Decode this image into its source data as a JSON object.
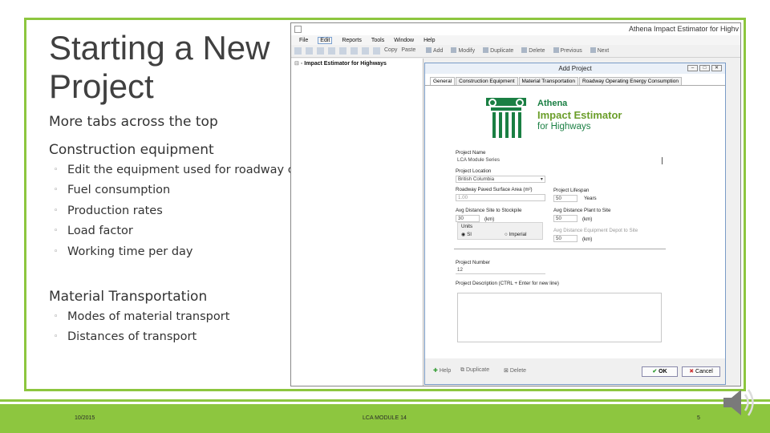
{
  "slide": {
    "title": "Starting a New Project",
    "subtitle": "More tabs across the top",
    "section1": "Construction equipment",
    "section1_items": [
      "Edit the equipment used for roadway construction",
      "Fuel consumption",
      "Production rates",
      "Load factor",
      "Working time per day"
    ],
    "section2": "Material Transportation",
    "section2_items": [
      "Modes of material transport",
      "Distances of transport"
    ],
    "bullet_glyph": "◦",
    "accent_color": "#8dc63f"
  },
  "footer": {
    "date": "10/2015",
    "module": "LCA MODULE 14",
    "page": "5"
  },
  "app": {
    "window_title": "Athena Impact Estimator for Highv",
    "menu": [
      "File",
      "Edit",
      "Reports",
      "Tools",
      "Window",
      "Help"
    ],
    "toolbar_left_count": 8,
    "toolbar_left": [
      "Copy",
      "Paste"
    ],
    "toolbar_right": [
      "Add",
      "Modify",
      "Duplicate",
      "Delete",
      "Previous",
      "Next"
    ],
    "tree_root": "Impact Estimator for Highways",
    "dialog": {
      "title": "Add Project",
      "tabs": [
        "General",
        "Construction Equipment",
        "Material Transportation",
        "Roadway Operating Energy Consumption"
      ],
      "logo": {
        "line1": "Athena",
        "line2": "Impact Estimator",
        "line3": "for Highways"
      },
      "project_name_label": "Project Name",
      "project_name_value": "LCA Module Series",
      "location_label": "Project Location",
      "location_value": "British Columbia",
      "surface_area_label": "Roadway Paved Surface Area (m²)",
      "surface_area_value": "1.00",
      "lifespan_label": "Project Lifespan",
      "lifespan_value": "50",
      "lifespan_unit": "Years",
      "dist_site_label": "Avg Distance Site to Stockpile",
      "dist_site_value": "30",
      "dist_site_unit": "(km)",
      "dist_plant_label": "Avg Distance Plant to Site",
      "dist_plant_value": "50",
      "dist_plant_unit": "(km)",
      "units_label": "Units",
      "unit_si": "SI",
      "unit_imperial": "Imperial",
      "disposal_label": "Avg Distance Equipment Depot to Site",
      "disposal_value": "50",
      "disposal_unit": "(km)",
      "project_number_label": "Project Number",
      "project_number_value": "12",
      "description_label": "Project Description (CTRL + Enter for new line)",
      "buttons": {
        "help": "Help",
        "duplicate": "Duplicate",
        "delete": "Delete",
        "ok": "OK",
        "cancel": "Cancel"
      }
    }
  }
}
